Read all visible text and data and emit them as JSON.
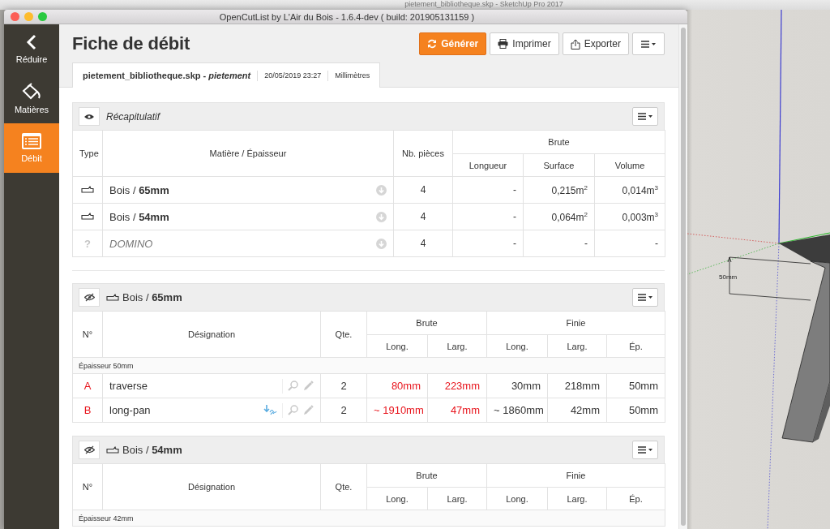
{
  "background_window": {
    "title": "pietement_bibliotheque.skp - SketchUp Pro 2017"
  },
  "window": {
    "title": "OpenCutList by L'Air du Bois - 1.6.4-dev ( build: 201905131159 )"
  },
  "sidebar": {
    "items": [
      {
        "kind": "back",
        "label": "Réduire",
        "selected": false
      },
      {
        "kind": "materials",
        "label": "Matières",
        "selected": false
      },
      {
        "kind": "cutlist",
        "label": "Débit",
        "selected": true
      }
    ]
  },
  "header": {
    "title": "Fiche de débit",
    "buttons": [
      {
        "kind": "refresh",
        "label": "Générer",
        "primary": true
      },
      {
        "kind": "print",
        "label": "Imprimer",
        "primary": false
      },
      {
        "kind": "export",
        "label": "Exporter",
        "primary": false
      },
      {
        "kind": "menu"
      }
    ]
  },
  "file_tab": {
    "model": "pietement_bibliotheque.skp - *pietement*",
    "date": "20/05/2019 23:27",
    "unit": "Millimètres"
  },
  "summary": {
    "title": "Récapitulatif",
    "visible": true,
    "columns": {
      "type": "Type",
      "material": "Matière / Épaisseur",
      "count": "Nb. pièces",
      "raw": "Brute",
      "raw_sub": [
        "Longueur",
        "Surface",
        "Volume"
      ]
    },
    "rows": [
      {
        "kind": "solid_wood",
        "material": "Bois / **65mm**",
        "count": "4",
        "length": "-",
        "area": "0,215m$^{2}$",
        "volume": "0,014m$^{3}$"
      },
      {
        "kind": "solid_wood",
        "material": "Bois / **54mm**",
        "count": "4",
        "length": "-",
        "area": "0,064m$^{2}$",
        "volume": "0,003m$^{3}$"
      },
      {
        "kind": "unknown",
        "symbol": "?",
        "material": "DOMINO",
        "count": "4",
        "length": "-",
        "area": "-",
        "volume": "-"
      }
    ]
  },
  "groups": [
    {
      "title": "Bois / **65mm**",
      "visible": false,
      "columns": {
        "number": "N°",
        "name": "Désignation",
        "quantity": "Qte.",
        "raw": "Brute",
        "raw_sub": [
          "Long.",
          "Larg."
        ],
        "finished": "Finie",
        "finished_sub": [
          "Long.",
          "Larg.",
          "Ép."
        ]
      },
      "thickness": "Épaisseur 50mm",
      "parts": [
        {
          "number": "A",
          "flagged": true,
          "name": "traverse",
          "oriented_grain": false,
          "quantity": "2",
          "raw_length": {
            "text": "80mm",
            "alert": true
          },
          "raw_width": {
            "text": "223mm",
            "alert": true
          },
          "length": "30mm",
          "width": "218mm",
          "thickness": "50mm"
        },
        {
          "number": "B",
          "flagged": true,
          "name": "long-pan",
          "oriented_grain": true,
          "quantity": "2",
          "raw_length": {
            "text": "~ 1910mm",
            "alert": true
          },
          "raw_width": {
            "text": "47mm",
            "alert": true
          },
          "length": "~ 1860mm",
          "width": "42mm",
          "thickness": "50mm"
        }
      ]
    },
    {
      "title": "Bois / **54mm**",
      "visible": false,
      "columns": {
        "number": "N°",
        "name": "Désignation",
        "quantity": "Qte.",
        "raw": "Brute",
        "raw_sub": [
          "Long.",
          "Larg."
        ],
        "finished": "Finie",
        "finished_sub": [
          "Long.",
          "Larg.",
          "Ép."
        ]
      },
      "thickness": "Épaisseur 42mm"
    }
  ],
  "viewport": {
    "dimension_label": "50mm"
  }
}
